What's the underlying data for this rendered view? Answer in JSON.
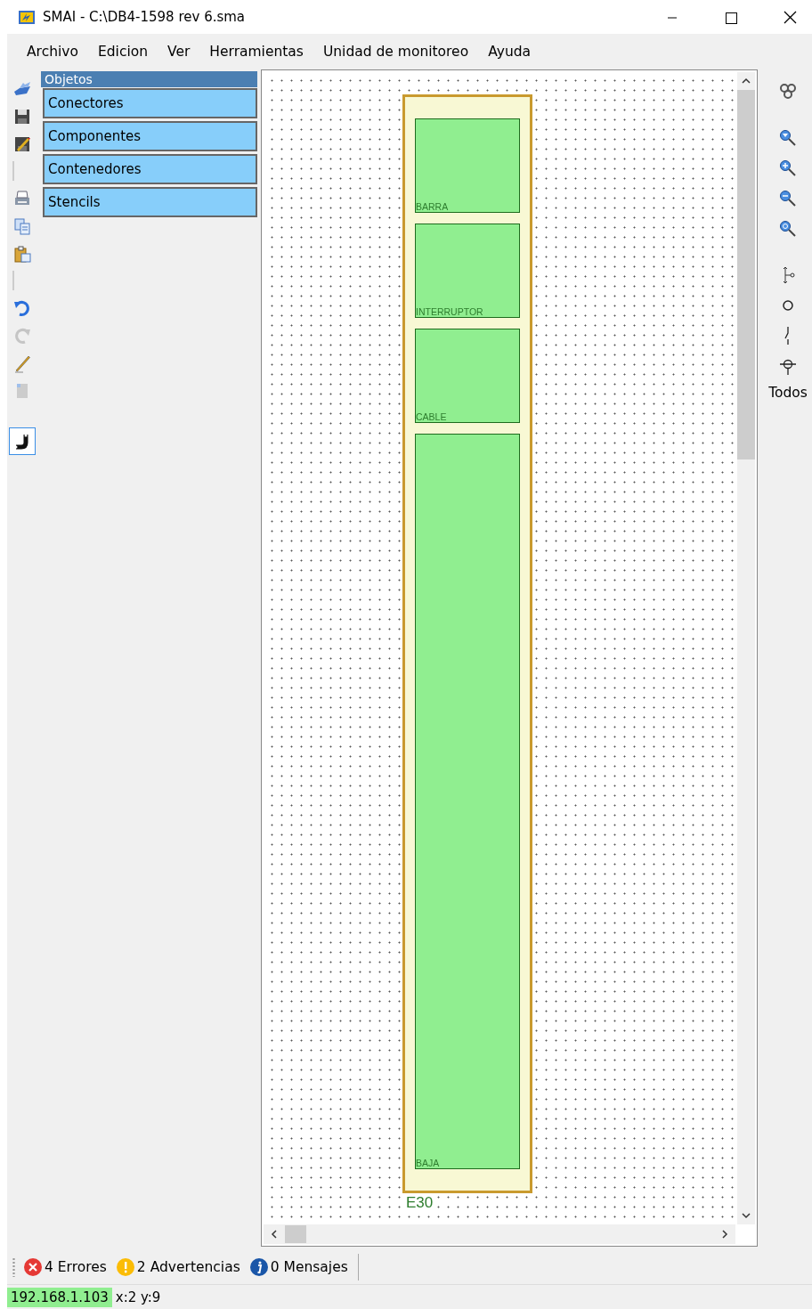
{
  "window": {
    "title": "SMAI - C:\\DB4-1598 rev 6.sma"
  },
  "menu": [
    "Archivo",
    "Edicion",
    "Ver",
    "Herramientas",
    "Unidad de monitoreo",
    "Ayuda"
  ],
  "left_toolbar": [
    {
      "kind": "open",
      "disabled": false,
      "selected": false
    },
    {
      "kind": "save",
      "disabled": false,
      "selected": false
    },
    {
      "kind": "save-as",
      "disabled": false,
      "selected": false
    },
    {
      "kind": "separator"
    },
    {
      "kind": "print",
      "disabled": false,
      "selected": false
    },
    {
      "kind": "copy",
      "disabled": false,
      "selected": false
    },
    {
      "kind": "paste",
      "disabled": false,
      "selected": false
    },
    {
      "kind": "separator"
    },
    {
      "kind": "undo",
      "disabled": false,
      "selected": false
    },
    {
      "kind": "redo",
      "disabled": true,
      "selected": false
    },
    {
      "kind": "pencil",
      "disabled": false,
      "selected": false
    },
    {
      "kind": "page",
      "disabled": true,
      "selected": false
    },
    {
      "kind": "gap"
    },
    {
      "kind": "pipe",
      "disabled": false,
      "selected": true
    }
  ],
  "objects_panel": {
    "title": "Objetos",
    "sections": [
      "Conectores",
      "Componentes",
      "Contenedores",
      "Stencils"
    ]
  },
  "diagram": {
    "container": {
      "label": "E30",
      "components": [
        {
          "label": "BARRA"
        },
        {
          "label": "INTERRUPTOR"
        },
        {
          "label": "CABLE"
        },
        {
          "label": "BAJA"
        }
      ]
    }
  },
  "right_toolbar": {
    "tools": [
      {
        "kind": "group"
      },
      {
        "kind": "gap"
      },
      {
        "kind": "zoom-fit"
      },
      {
        "kind": "zoom-in"
      },
      {
        "kind": "zoom-out"
      },
      {
        "kind": "zoom-reset"
      },
      {
        "kind": "gap"
      },
      {
        "kind": "connector"
      },
      {
        "kind": "circle"
      },
      {
        "kind": "switch"
      },
      {
        "kind": "ground"
      }
    ],
    "label": "Todos"
  },
  "messages": [
    {
      "kind": "error",
      "text": "4 Errores"
    },
    {
      "kind": "warning",
      "text": "2 Advertencias"
    },
    {
      "kind": "info",
      "text": "0 Mensajes"
    }
  ],
  "status_bar": {
    "ip": "192.168.1.103",
    "coordinates": "x:2 y:9"
  }
}
